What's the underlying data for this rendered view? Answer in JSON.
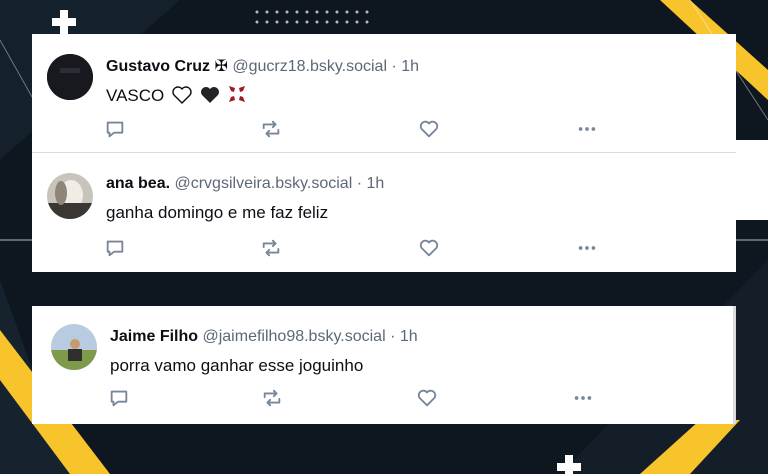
{
  "colors": {
    "background": "#0e1620",
    "accent_yellow": "#f7c42b",
    "text_primary": "#0b0f14",
    "text_secondary": "#5d6876",
    "icon": "#788699",
    "divider": "#d9dde2"
  },
  "posts": [
    {
      "name": "Gustavo Cruz ✠",
      "handle": "@gucrz18.bsky.social",
      "time": "· 1h",
      "text": "VASCO",
      "emojis": [
        "white-heart",
        "black-heart",
        "anger-symbol"
      ]
    },
    {
      "name": "ana bea.",
      "handle": "@crvgsilveira.bsky.social",
      "time": "· 1h",
      "text": "ganha domingo e me faz feliz",
      "emojis": []
    },
    {
      "name": "Jaime Filho",
      "handle": "@jaimefilho98.bsky.social",
      "time": "· 1h",
      "text": "porra vamo ganhar esse joguinho",
      "emojis": []
    }
  ],
  "action_icons": [
    "reply-icon",
    "repost-icon",
    "like-icon",
    "more-icon"
  ]
}
